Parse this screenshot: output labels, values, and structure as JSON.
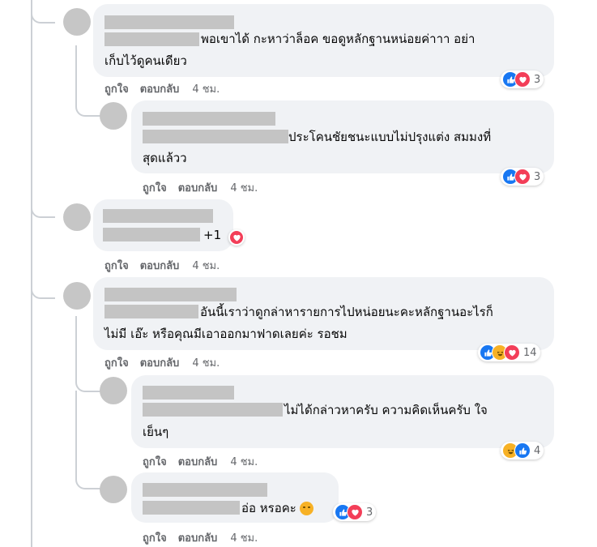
{
  "actions": {
    "like": "ถูกใจ",
    "reply": "ตอบกลับ",
    "time": "4 ชม."
  },
  "icons": {
    "like": "thumbs-up-icon",
    "love": "heart-icon",
    "haha": "laughing-face-icon",
    "smile": "smirking-face-emoji"
  },
  "colors": {
    "bubble": "#f0f2f5",
    "like": "#1877f2",
    "love": "#f33e58",
    "haha": "#f7b125",
    "meta": "#65676b"
  },
  "comments": [
    {
      "line1": "พอเขาได้ กะหาว่าล็อค ขอดูหลักฐานหน่อยค่าาา อย่า",
      "line2": "เก็บไว้ดูคนเดียว",
      "reaction_count": "3"
    },
    {
      "line1": "ประโคนชัยชนะแบบไม่ปรุงแต่ง สมมงที่",
      "line2": "สุดแล้วว",
      "reaction_count": "3"
    },
    {
      "line1": "+1"
    },
    {
      "line1": "อันนี้เราว่าดูกล่าหารายการไปหน่อยนะคะหลักฐานอะไรก็",
      "line2": "ไม่มี เอ๊ะ หรือคุณมีเอาออกมาฟาดเลยค่ะ รอชม",
      "reaction_count": "14"
    },
    {
      "line1": "ไม่ได้กล่าวหาครับ ความคิดเห็นครับ ใจ",
      "line2": "เย็นๆ",
      "reaction_count": "4"
    },
    {
      "line1": "อ่อ หรอคะ",
      "reaction_count": "3"
    }
  ]
}
